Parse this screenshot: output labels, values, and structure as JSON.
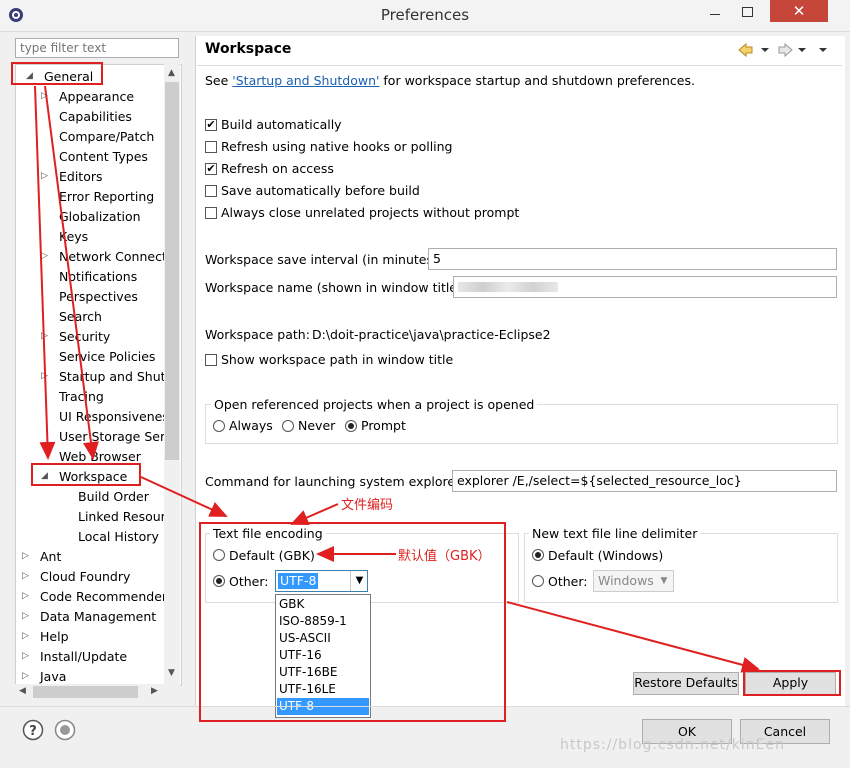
{
  "window": {
    "title": "Preferences",
    "close": "✕"
  },
  "filter": {
    "placeholder": "type filter text"
  },
  "tree": [
    {
      "label": "General",
      "twisty": "◢"
    },
    {
      "label": "Appearance",
      "twisty": "▷"
    },
    {
      "label": "Capabilities",
      "twisty": ""
    },
    {
      "label": "Compare/Patch",
      "twisty": ""
    },
    {
      "label": "Content Types",
      "twisty": ""
    },
    {
      "label": "Editors",
      "twisty": "▷"
    },
    {
      "label": "Error Reporting",
      "twisty": ""
    },
    {
      "label": "Globalization",
      "twisty": ""
    },
    {
      "label": "Keys",
      "twisty": ""
    },
    {
      "label": "Network Connectio",
      "twisty": "▷"
    },
    {
      "label": "Notifications",
      "twisty": ""
    },
    {
      "label": "Perspectives",
      "twisty": ""
    },
    {
      "label": "Search",
      "twisty": ""
    },
    {
      "label": "Security",
      "twisty": "▷"
    },
    {
      "label": "Service Policies",
      "twisty": ""
    },
    {
      "label": "Startup and Shutd",
      "twisty": "▷"
    },
    {
      "label": "Tracing",
      "twisty": ""
    },
    {
      "label": "UI Responsiveness",
      "twisty": ""
    },
    {
      "label": "User Storage Serv",
      "twisty": ""
    },
    {
      "label": "Web Browser",
      "twisty": ""
    },
    {
      "label": "Workspace",
      "twisty": "◢"
    },
    {
      "label": "Build Order",
      "twisty": ""
    },
    {
      "label": "Linked Resourc",
      "twisty": ""
    },
    {
      "label": "Local History",
      "twisty": ""
    },
    {
      "label": "Ant",
      "twisty": "▷"
    },
    {
      "label": "Cloud Foundry",
      "twisty": "▷"
    },
    {
      "label": "Code Recommenders",
      "twisty": "▷"
    },
    {
      "label": "Data Management",
      "twisty": "▷"
    },
    {
      "label": "Help",
      "twisty": "▷"
    },
    {
      "label": "Install/Update",
      "twisty": "▷"
    },
    {
      "label": "Java",
      "twisty": "▷"
    }
  ],
  "page": {
    "title": "Workspace",
    "see_prefix": "See ",
    "see_link": "'Startup and Shutdown'",
    "see_suffix": " for workspace startup and shutdown preferences.",
    "checks": [
      {
        "label": "Build automatically",
        "checked": true
      },
      {
        "label": "Refresh using native hooks or polling",
        "checked": false
      },
      {
        "label": "Refresh on access",
        "checked": true
      },
      {
        "label": "Save automatically before build",
        "checked": false
      },
      {
        "label": "Always close unrelated projects without prompt",
        "checked": false
      }
    ],
    "save_interval_label": "Workspace save interval (in minutes):",
    "save_interval_value": "5",
    "ws_name_label": "Workspace name (shown in window title):",
    "ws_name_value": "",
    "ws_path_label": "Workspace path:",
    "ws_path_value": "D:\\doit-practice\\java\\practice-Eclipse2",
    "show_path_label": "Show workspace path in window title",
    "open_group_title": "Open referenced projects when a project is opened",
    "open_opts": [
      "Always",
      "Never",
      "Prompt"
    ],
    "cmd_label": "Command for launching system explorer:",
    "cmd_value": "explorer /E,/select=${selected_resource_loc}",
    "enc_group_title": "Text file encoding",
    "enc_default": "Default (GBK)",
    "enc_other": "Other:",
    "enc_value": "UTF-8",
    "enc_options": [
      "GBK",
      "ISO-8859-1",
      "US-ASCII",
      "UTF-16",
      "UTF-16BE",
      "UTF-16LE",
      "UTF-8"
    ],
    "delim_group_title": "New text file line delimiter",
    "delim_default": "Default (Windows)",
    "delim_other": "Other:",
    "delim_value": "Windows",
    "restore_defaults": "Restore Defaults",
    "apply": "Apply"
  },
  "footer": {
    "ok": "OK",
    "cancel": "Cancel"
  },
  "annotations": {
    "file_encoding": "文件编码",
    "default_value": "默认值（GBK）"
  },
  "watermark": "https://blog.csdn.net/kinEen",
  "colors": {
    "annotation": "#e02020",
    "selection": "#3399ff"
  }
}
